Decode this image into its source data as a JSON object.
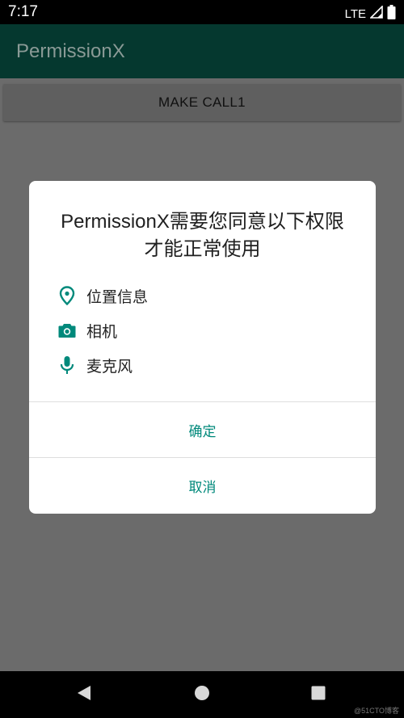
{
  "status_bar": {
    "time": "7:17",
    "network": "LTE"
  },
  "app_bar": {
    "title": "PermissionX"
  },
  "main": {
    "make_call_label": "MAKE CALL1"
  },
  "dialog": {
    "title_line1": "PermissionX需要您同意以下权限",
    "title_line2": "才能正常使用",
    "permissions": [
      {
        "icon": "location-pin-icon",
        "label": "位置信息"
      },
      {
        "icon": "camera-icon",
        "label": "相机"
      },
      {
        "icon": "microphone-icon",
        "label": "麦克风"
      }
    ],
    "confirm_label": "确定",
    "cancel_label": "取消"
  },
  "colors": {
    "accent": "#00897b",
    "app_bar": "#05382f",
    "scrim": "#6b6b6b"
  },
  "watermark": "@51CTO博客"
}
